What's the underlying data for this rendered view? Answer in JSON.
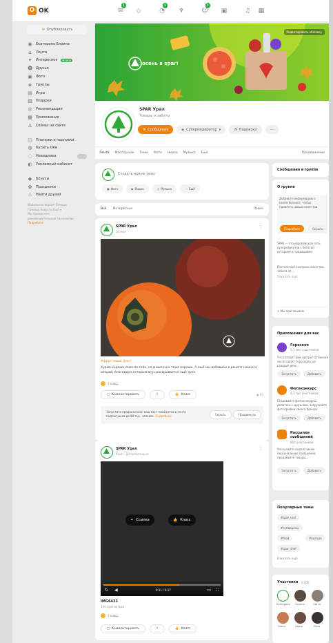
{
  "topbar": {
    "logo_text": "OK",
    "nav_badges": [
      "1",
      "1",
      "1"
    ]
  },
  "sidebar": {
    "publish_button": "Опубликовать",
    "items": [
      {
        "label": "Екатерина Блоина",
        "icon": "user-icon"
      },
      {
        "label": "Лента",
        "icon": "feed-icon"
      },
      {
        "label": "Интересное",
        "icon": "interesting-icon",
        "badge": "Новое"
      },
      {
        "label": "Друзья",
        "icon": "friends-icon"
      },
      {
        "label": "Фото",
        "icon": "photo-icon"
      },
      {
        "label": "Группы",
        "icon": "groups-icon"
      },
      {
        "label": "Игры",
        "icon": "games-icon"
      },
      {
        "label": "Подарки",
        "icon": "gift-icon"
      },
      {
        "label": "Рекомендации",
        "icon": "recommend-icon"
      },
      {
        "label": "Приложения",
        "icon": "apps-icon"
      },
      {
        "label": "Сейчас на сайте",
        "icon": "online-icon"
      }
    ],
    "items2": [
      {
        "label": "Платежи и подписки",
        "icon": "payment-icon"
      },
      {
        "label": "Купить ОКи",
        "icon": "coin-icon"
      },
      {
        "label": "Невидимка",
        "icon": "invisible-icon",
        "toggle": true
      },
      {
        "label": "Рекламный кабинет",
        "icon": "ads-icon"
      }
    ],
    "items3": [
      {
        "label": "Бонусы",
        "icon": "bonus-icon"
      },
      {
        "label": "Праздники",
        "icon": "holiday-icon"
      },
      {
        "label": "Найти друзей",
        "icon": "find-friends-icon"
      }
    ],
    "footer_lines": [
      "Мобильная версия  Помощь",
      "Помощь  Новости  Ещё ▾",
      "Мы применяем",
      "рекомендательные технологии"
    ],
    "footer_link": "Подробнее"
  },
  "group": {
    "cover_text": "осень в spar!",
    "cover_button": "Редактировать обложку",
    "name": "SPAR Урал",
    "subtitle": "Товары и заботы",
    "buttons": [
      "Сообщения",
      "Супермодератор",
      "Подписки",
      "⋯"
    ],
    "tabs": [
      "Лента",
      "Мастерская",
      "Темы",
      "Фото",
      "Видео",
      "Музыка",
      "Ещё"
    ],
    "tabs_right": "Продвижение",
    "colors": {
      "brand_green": "#2ea836",
      "accent": "#ee8208"
    }
  },
  "publish": {
    "placeholder": "Создать новую тему",
    "chips": [
      {
        "label": "Фото",
        "icon": "photo-icon"
      },
      {
        "label": "Видео",
        "icon": "video-icon"
      },
      {
        "label": "Музыка",
        "icon": "music-icon"
      },
      {
        "label": "Ещё",
        "icon": "more-icon"
      }
    ]
  },
  "filter": {
    "tabs": [
      "Всё",
      "Интересное"
    ],
    "right": "Поиск"
  },
  "post1": {
    "author": "SPAR Урал",
    "meta": "10 мин",
    "tag": "#фруктовый_факт",
    "text": "Хурма хороша сама по себе, но в выпечке тоже хорошо. А ещё мы добавили в рецепт немного специй, благодаря которым вкус раскрывается ещё ярче.",
    "likes": "1 класс",
    "actions": [
      "Комментировать",
      "",
      "Класс"
    ],
    "views": "42",
    "promo_text": "Запустите продвижение: ваш пост покажется в ленте подписчиков до 80 тыс. человек.",
    "promo_link": "Подробнее",
    "promo_buttons": [
      "Скрыть",
      "Продвинуть"
    ]
  },
  "post2": {
    "author": "SPAR Урал",
    "meta": "Клип · Дополнительно",
    "video_buttons": [
      "Ссылка",
      "Класс"
    ],
    "time": "0:11 / 0:17",
    "title": "IMG6433",
    "sub": "156 просмотров",
    "likes": "1 класс",
    "actions": [
      "Комментировать",
      "",
      "Класс"
    ]
  },
  "right": {
    "messages_title": "Сообщения в группе",
    "about_title": "О группе",
    "about_text": "Добавьте информацию о своём бизнесе, чтобы привлечь новых клиентов",
    "about_buttons": [
      "Подробнее",
      "Скрыть"
    ],
    "about_desc": "SPAR — это европейская сеть супермаркетов с богатой историей и традициями",
    "about_desc2": "Постоянный контроль качества, забота об ...",
    "about_more": "Показать ещё",
    "about_link": "Мы приглашаем",
    "apps_title": "Приложения для вас",
    "apps": [
      {
        "name": "Гороскоп",
        "sub": "1,1 млн участников",
        "desc": "Что готовит вам завтра? Отличная ли сегодня? Гороскопы на каждый день...",
        "color": "#7b3fd0"
      },
      {
        "name": "Фотоконкурс",
        "sub": "4,3 тыс участников",
        "desc": "Создавайте фотоконкурсы, делитесь с друзьями, загружайте фотографии своего бренда",
        "color": "#ee8208"
      },
      {
        "name": "Рассылки сообщений",
        "sub": "800 участников",
        "desc": "Рассылайте подписчикам персональные сообщения, продавайте товары...",
        "color": "#ee8208"
      }
    ],
    "app_buttons": [
      "Запустить",
      "Добавить"
    ],
    "topics_title": "Популярные темы",
    "topics": [
      "#spar_ural",
      "#суперцены",
      "#food",
      "#выгода",
      "#spar_chef"
    ],
    "topics_more": "Показать ещё",
    "members_title": "Участники",
    "members_count": "3 000",
    "members": [
      "Екатерина",
      "Полина",
      "Света",
      "Ольга",
      "Дарья",
      "Рома"
    ]
  }
}
